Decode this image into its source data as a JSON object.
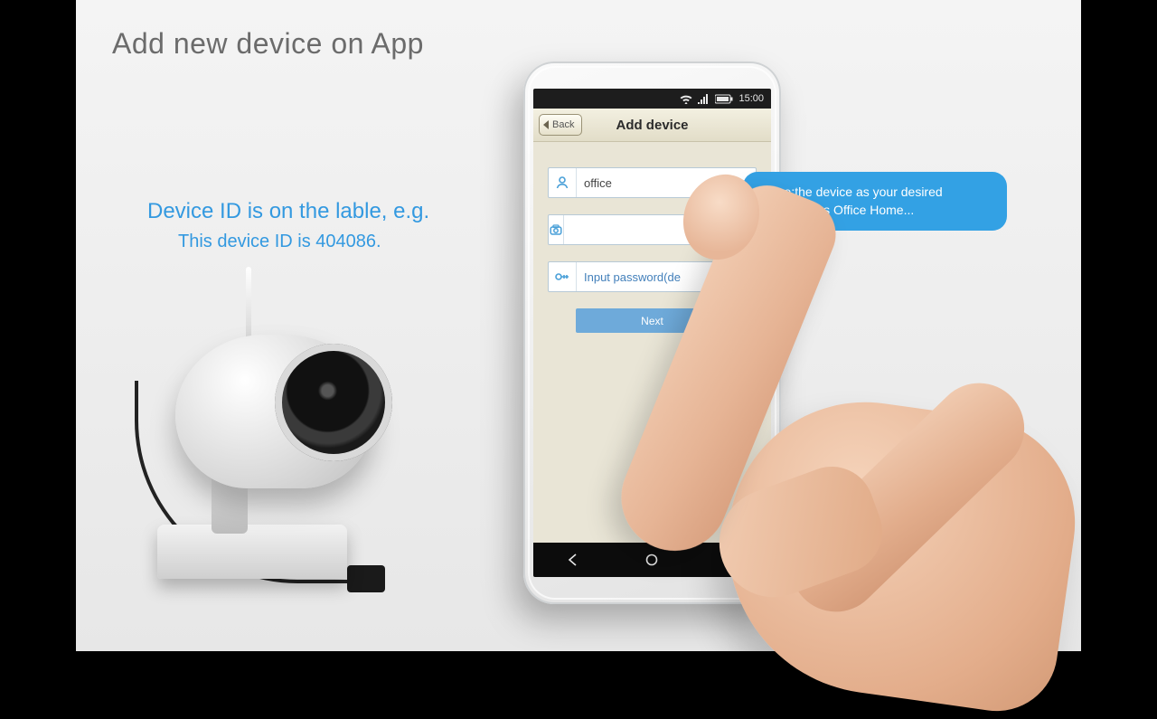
{
  "page": {
    "title": "Add new device on App",
    "device_id_line1": "Device ID is on the lable, e.g.",
    "device_id_line2": "This device ID is 404086."
  },
  "phone": {
    "status": {
      "time": "15:00"
    },
    "nav": {
      "back": "Back",
      "title": "Add device"
    },
    "form": {
      "name_value": "office",
      "id_value": "",
      "password_placeholder": "Input password(de",
      "next_label": "Next"
    }
  },
  "tooltip": {
    "text": "Name:the device as your desired here.such as Office Home..."
  }
}
